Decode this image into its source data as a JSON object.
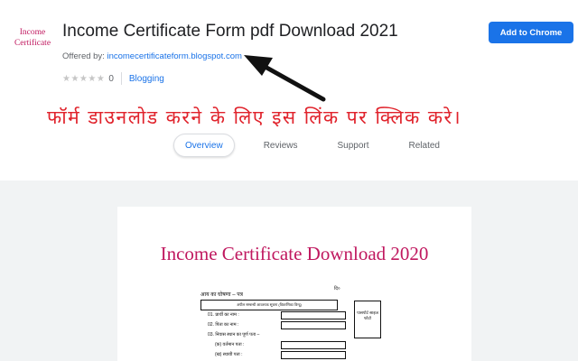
{
  "header": {
    "logo_line1": "Income",
    "logo_line2": "Certificate",
    "title": "Income Certificate Form pdf Download 2021",
    "offered_by_label": "Offered by:",
    "offered_by_link": "incomecertificateform.blogspot.com",
    "stars": "★★★★★",
    "rating_count": "0",
    "category": "Blogging",
    "add_button": "Add to Chrome"
  },
  "annotation": {
    "hindi_text": "फॉर्म डाउनलोड करने के लिए इस लिंक पर क्लिक करे।"
  },
  "tabs": [
    {
      "label": "Overview",
      "active": true
    },
    {
      "label": "Reviews",
      "active": false
    },
    {
      "label": "Support",
      "active": false
    },
    {
      "label": "Related",
      "active": false
    }
  ],
  "screenshot": {
    "title": "Income Certificate Download 2020",
    "form_heading": "आय का घोषणा – पत्र",
    "form_subheading": "अपील सम्बन्धी आवश्यक सूचना (विवरणिका विन्दु)",
    "form_right_label": "दि०",
    "photo_label": "पासपोर्ट साइज फोटो",
    "fields": [
      "01. प्रार्थी का नाम :",
      "02. पिता का नाम :",
      "03. निवास स्थान का पूर्ण पता –",
      "(क) वर्तमान पता :",
      "(ख) स्थायी पता :"
    ]
  },
  "colors": {
    "accent": "#1a73e8",
    "annotation_red": "#e0222b",
    "logo_magenta": "#c0185f",
    "gallery_bg": "#f1f3f4"
  }
}
